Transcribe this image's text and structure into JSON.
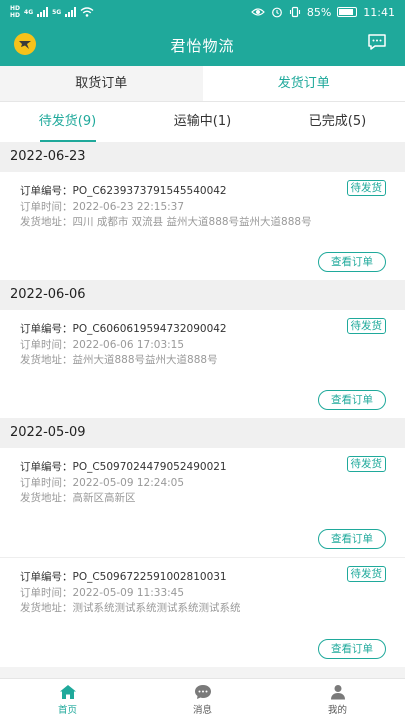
{
  "status_bar": {
    "network_labels": [
      "HD",
      "HD"
    ],
    "network_type": "4G",
    "network_type2": "5G",
    "battery": "85%",
    "time": "11:41"
  },
  "header": {
    "title": "君怡物流"
  },
  "top_tabs": [
    {
      "label": "取货订单",
      "active": false
    },
    {
      "label": "发货订单",
      "active": true
    }
  ],
  "sub_tabs": [
    {
      "label": "待发货(9)",
      "active": true
    },
    {
      "label": "运输中(1)",
      "active": false
    },
    {
      "label": "已完成(5)",
      "active": false
    }
  ],
  "labels": {
    "order_no": "订单编号：",
    "order_time": "订单时间：",
    "address": "发货地址：",
    "view_button": "查看订单"
  },
  "groups": [
    {
      "date": "2022-06-23",
      "orders": [
        {
          "order_no": "PO_C6239373791545540042",
          "status": "待发货",
          "time": "2022-06-23 22:15:37",
          "address": "四川 成都市 双流县 益州大道888号益州大道888号"
        }
      ]
    },
    {
      "date": "2022-06-06",
      "orders": [
        {
          "order_no": "PO_C6060619594732090042",
          "status": "待发货",
          "time": "2022-06-06 17:03:15",
          "address": "益州大道888号益州大道888号"
        }
      ]
    },
    {
      "date": "2022-05-09",
      "orders": [
        {
          "order_no": "PO_C5097024479052490021",
          "status": "待发货",
          "time": "2022-05-09 12:24:05",
          "address": "高新区高新区"
        },
        {
          "order_no": "PO_C5096722591002810031",
          "status": "待发货",
          "time": "2022-05-09 11:33:45",
          "address": "测试系统测试系统测试系统测试系统"
        }
      ]
    }
  ],
  "bottom_nav": [
    {
      "label": "首页",
      "icon": "home-icon",
      "active": true
    },
    {
      "label": "消息",
      "icon": "message-icon",
      "active": false
    },
    {
      "label": "我的",
      "icon": "profile-icon",
      "active": false
    }
  ],
  "colors": {
    "accent": "#1fa99b",
    "logo": "#f6c21a"
  }
}
